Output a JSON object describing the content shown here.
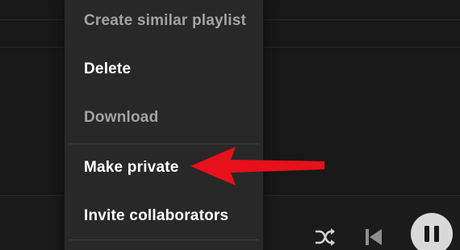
{
  "menu": {
    "items": [
      {
        "label": "Create similar playlist",
        "enabled": false
      },
      {
        "label": "Delete",
        "enabled": true
      },
      {
        "label": "Download",
        "enabled": false
      },
      {
        "label": "Make private",
        "enabled": true
      },
      {
        "label": "Invite collaborators",
        "enabled": true
      }
    ]
  },
  "annotation": {
    "arrow_color": "#e8101a",
    "points_to": "Make private"
  },
  "player": {
    "controls": [
      "shuffle-icon",
      "previous-icon",
      "pause-icon"
    ]
  },
  "colors": {
    "background": "#181818",
    "menu_background": "#282828",
    "text_enabled": "#ffffff",
    "text_disabled": "#a3a3a3"
  }
}
